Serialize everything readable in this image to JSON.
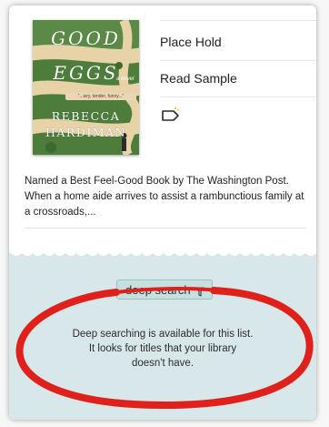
{
  "book": {
    "cover": {
      "title_line1": "GOOD",
      "title_line2": "EGGS",
      "novel_label": "a novel",
      "blurb": "“...wry, tender, funny...”",
      "author_line1": "REBECCA",
      "author_line2": "HARDIMAN"
    },
    "actions": {
      "place_hold": "Place Hold",
      "read_sample": "Read Sample"
    },
    "description": "Named a Best Feel-Good Book by The Washington Post. When a home aide arrives to assist a rambunctious family at a crossroads,..."
  },
  "deep_search": {
    "chip_label": "deep search",
    "message_line1": "Deep searching is available for this list.",
    "message_line2": "It looks for titles that your library",
    "message_line3": "doesn't have."
  },
  "icons": {
    "tag": "tag-icon",
    "filter": "filter-icon"
  },
  "colors": {
    "panel_bg": "#d8e7e9",
    "chip_bg": "#c7dfdf",
    "annotation_red": "#e0201b",
    "cover_green": "#4b7a3a"
  }
}
